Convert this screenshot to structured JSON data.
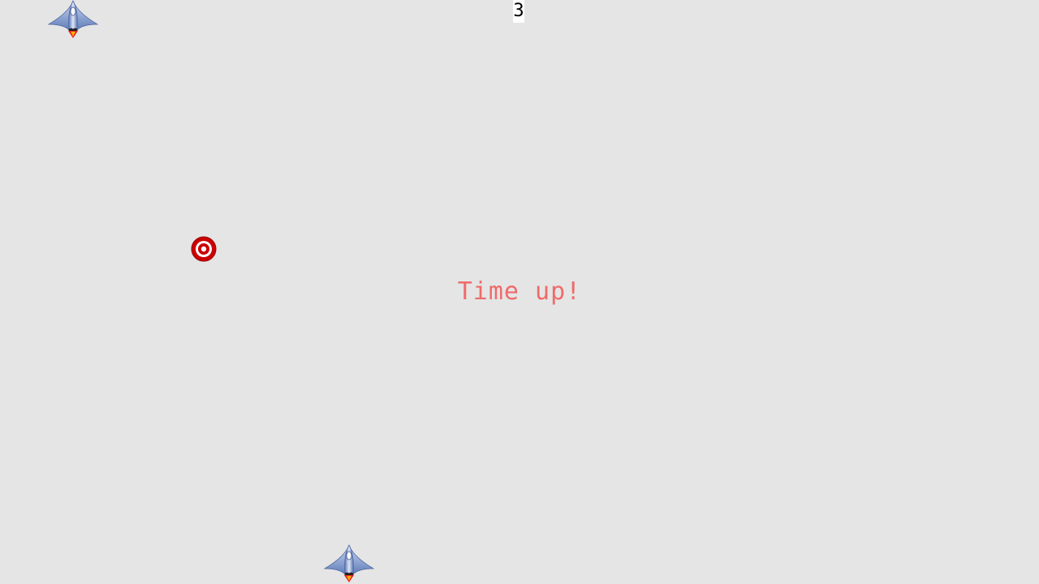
{
  "hud": {
    "score": "3"
  },
  "overlay": {
    "message": "Time up!",
    "color": "#f06a6a"
  },
  "sprites": {
    "enemy": "spaceship-icon",
    "player": "spaceship-icon",
    "target": "bullseye-target-icon"
  },
  "colors": {
    "background": "#e5e5e5",
    "target": "#cc0000",
    "ship_body": "#6f8fc8"
  }
}
